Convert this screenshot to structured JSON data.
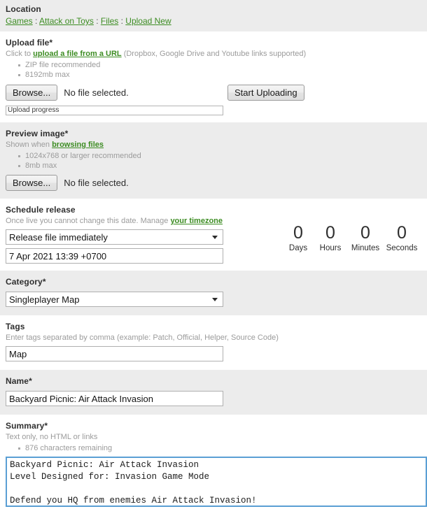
{
  "location": {
    "title": "Location",
    "separator": ":",
    "crumbs": [
      {
        "label": "Games"
      },
      {
        "label": "Attack on Toys"
      },
      {
        "label": "Files"
      },
      {
        "label": "Upload New"
      }
    ]
  },
  "upload_file": {
    "title": "Upload file*",
    "hint_prefix": "Click to",
    "hint_link": "upload a file from a URL",
    "hint_suffix": "(Dropbox, Google Drive and Youtube links supported)",
    "notes": [
      "ZIP file recommended",
      "8192mb max"
    ],
    "browse_label": "Browse...",
    "file_status": "No file selected.",
    "start_upload_label": "Start Uploading",
    "progress_label": "Upload progress",
    "progress_percent": 0
  },
  "preview_image": {
    "title": "Preview image*",
    "hint_prefix": "Shown when",
    "hint_link": "browsing files",
    "notes": [
      "1024x768 or larger recommended",
      "8mb max"
    ],
    "browse_label": "Browse...",
    "file_status": "No file selected."
  },
  "schedule": {
    "title": "Schedule release",
    "hint_prefix": "Once live you cannot change this date. Manage",
    "hint_link": "your timezone",
    "release_option": "Release file immediately",
    "release_options": [
      "Release file immediately"
    ],
    "date_value": "7 Apr 2021 13:39 +0700",
    "countdown": [
      {
        "value": "0",
        "label": "Days"
      },
      {
        "value": "0",
        "label": "Hours"
      },
      {
        "value": "0",
        "label": "Minutes"
      },
      {
        "value": "0",
        "label": "Seconds"
      }
    ]
  },
  "category": {
    "title": "Category*",
    "selected": "Singleplayer Map",
    "options": [
      "Singleplayer Map"
    ]
  },
  "tags": {
    "title": "Tags",
    "hint": "Enter tags separated by comma (example: Patch, Official, Helper, Source Code)",
    "value": "Map"
  },
  "name": {
    "title": "Name*",
    "value": "Backyard Picnic: Air Attack Invasion"
  },
  "summary": {
    "title": "Summary*",
    "hint": "Text only, no HTML or links",
    "note": "876 characters remaining",
    "value": "Backyard Picnic: Air Attack Invasion\nLevel Designed for: Invasion Game Mode\n\nDefend you HQ from enemies Air Attack Invasion!"
  },
  "colors": {
    "link_green": "#3c8c22",
    "shade_bg": "#ececec",
    "focus_border": "#5a9fd4"
  }
}
